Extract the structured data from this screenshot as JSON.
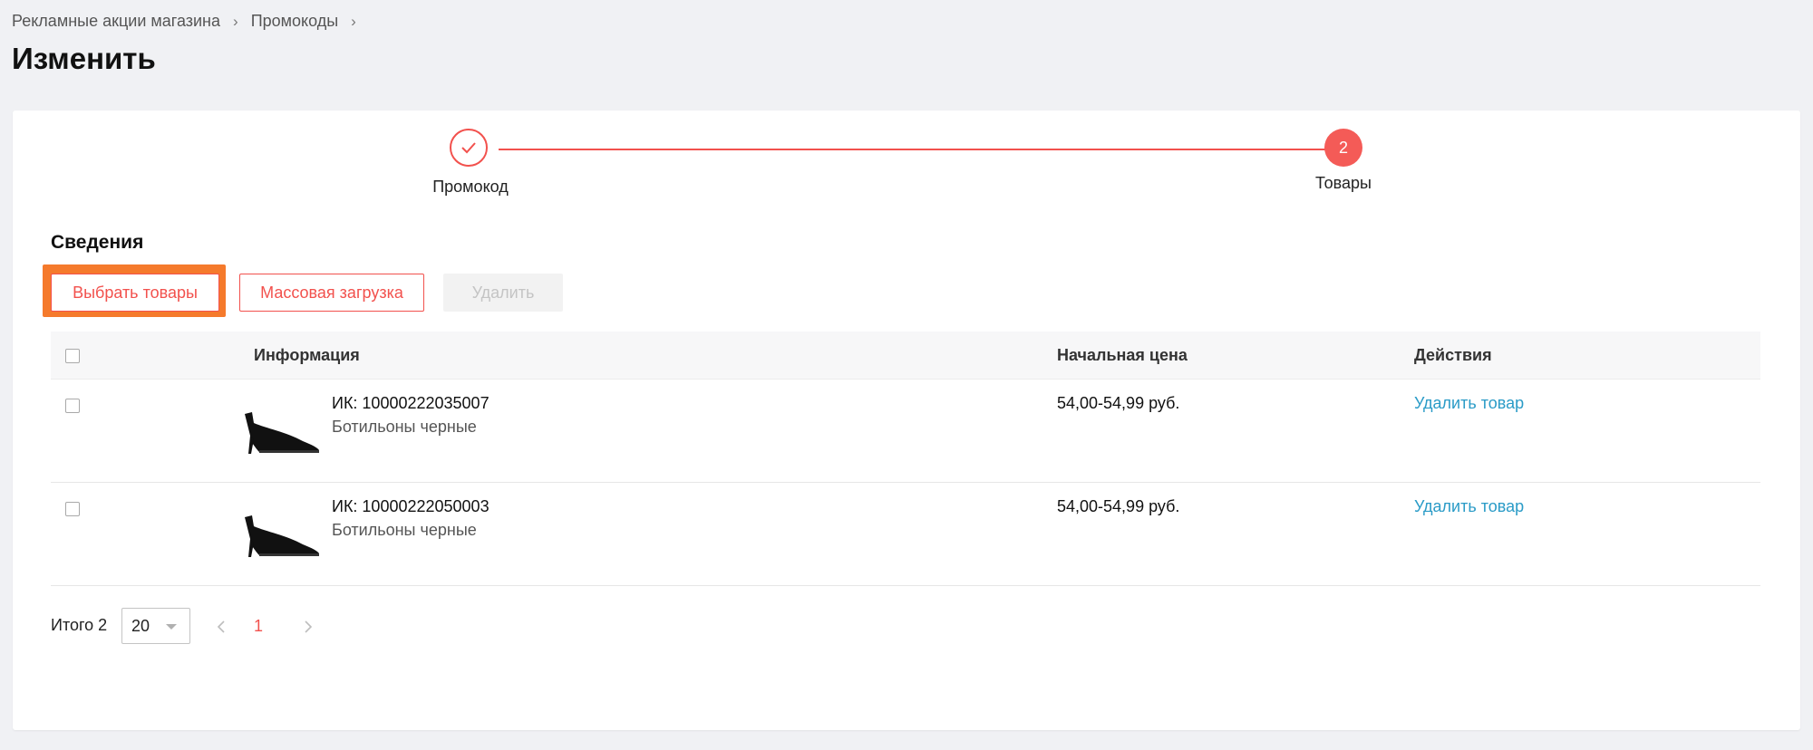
{
  "breadcrumb": {
    "items": [
      "Рекламные акции магазина",
      "Промокоды"
    ]
  },
  "page_title": "Изменить",
  "stepper": {
    "steps": [
      {
        "label": "Промокод",
        "state": "done"
      },
      {
        "label": "Товары",
        "number": "2",
        "state": "active"
      }
    ],
    "accent_color": "#f2514d"
  },
  "section_title": "Сведения",
  "toolbar": {
    "select_label": "Выбрать товары",
    "mass_upload_label": "Массовая загрузка",
    "delete_label": "Удалить"
  },
  "table": {
    "columns": [
      "Информация",
      "Начальная цена",
      "Действия"
    ],
    "rows": [
      {
        "sku": "ИК: 10000222035007",
        "name": "Ботильоны черные",
        "price": "54,00-54,99 руб.",
        "action": "Удалить товар",
        "image": "black-ankle-boot"
      },
      {
        "sku": "ИК: 10000222050003",
        "name": "Ботильоны черные",
        "price": "54,00-54,99 руб.",
        "action": "Удалить товар",
        "image": "black-ankle-boot"
      }
    ]
  },
  "pagination": {
    "total_label": "Итого 2",
    "page_size": "20",
    "current_page": "1"
  },
  "colors": {
    "accent": "#f2514d",
    "link": "#2a9bc7",
    "highlight": "#f57a2c",
    "background": "#f0f1f4"
  }
}
